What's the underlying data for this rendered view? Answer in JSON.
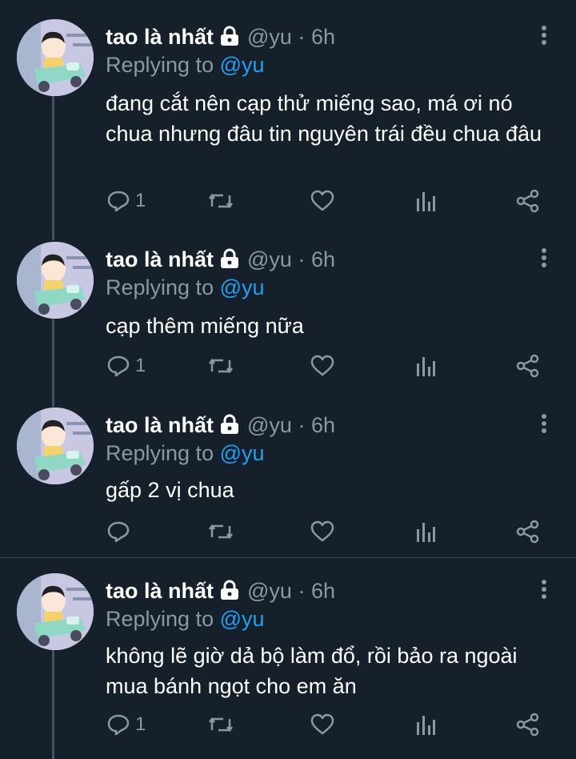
{
  "tweets": [
    {
      "name": "tao là nhất",
      "handle": "@yu",
      "time": "6h",
      "replying_label": "Replying to",
      "replying_to": "@yu",
      "text": "đang cắt nên cạp thử miếng sao, má ơi nó chua nhưng đâu tin nguyên trái đều chua đâu",
      "reply_count": "1"
    },
    {
      "name": "tao là nhất",
      "handle": "@yu",
      "time": "6h",
      "replying_label": "Replying to",
      "replying_to": "@yu",
      "text": "cạp thêm miếng nữa",
      "reply_count": "1"
    },
    {
      "name": "tao là nhất",
      "handle": "@yu",
      "time": "6h",
      "replying_label": "Replying to",
      "replying_to": "@yu",
      "text": "gấp 2 vị chua",
      "reply_count": ""
    },
    {
      "name": "tao là nhất",
      "handle": "@yu",
      "time": "6h",
      "replying_label": "Replying to",
      "replying_to": "@yu",
      "text": "không lẽ giờ dả bộ làm đổ, rồi bảo ra ngoài mua bánh ngọt cho em ăn",
      "reply_count": "1"
    }
  ],
  "separator": "·",
  "icons": {
    "lock": "lock-icon",
    "more": "more-vertical-icon",
    "reply": "reply-icon",
    "retweet": "retweet-icon",
    "like": "heart-icon",
    "analytics": "analytics-icon",
    "share": "share-icon"
  },
  "colors": {
    "background": "#15202b",
    "muted": "#8899a6",
    "link": "#1da1f2",
    "thread_line": "#3d5466"
  }
}
